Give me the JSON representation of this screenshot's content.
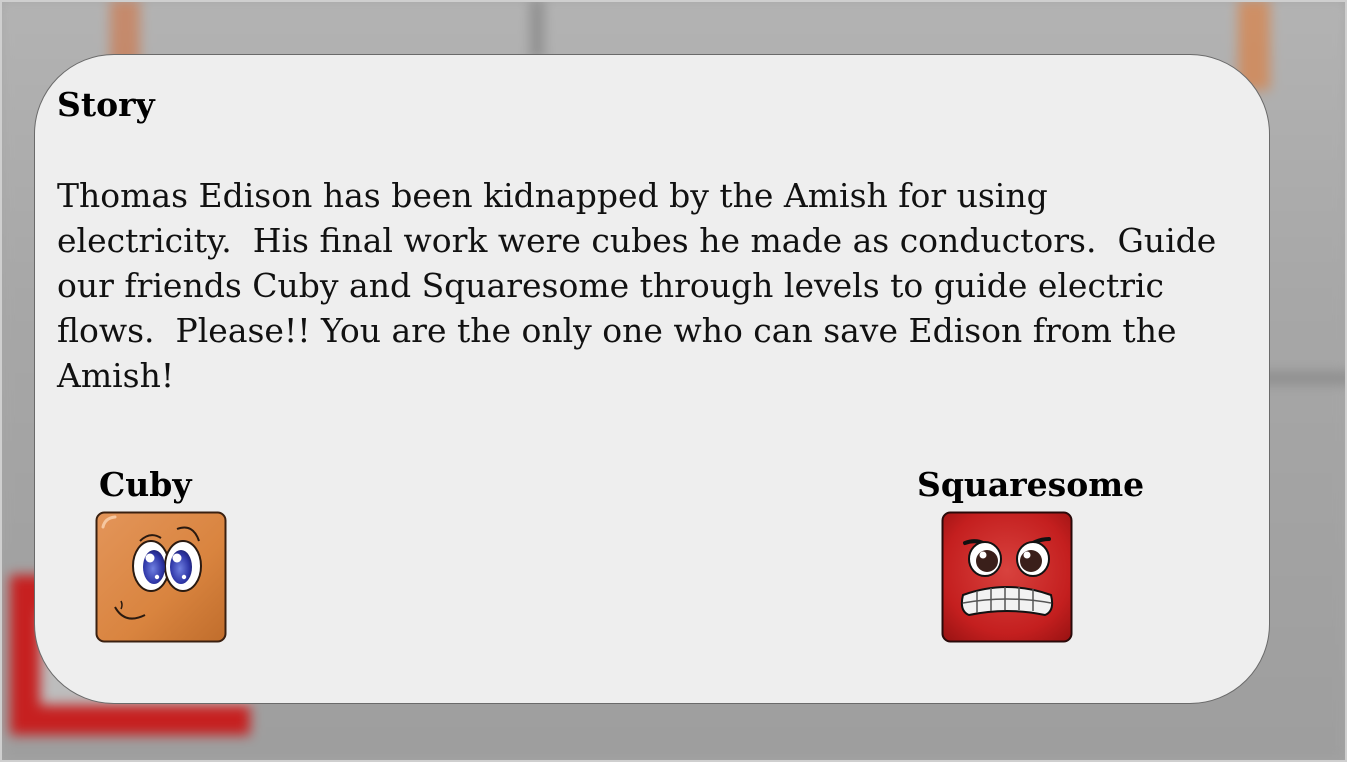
{
  "story": {
    "title": "Story",
    "text": "Thomas Edison has been kidnapped by the Amish for using\nelectricity.  His final work were cubes he made as conductors.  Guide\nour friends Cuby and Squaresome through levels to guide electric\nflows.  Please!! You are the only one who can save Edison from the\nAmish!"
  },
  "characters": {
    "cuby": {
      "name": "Cuby",
      "color": "#d9843f"
    },
    "squaresome": {
      "name": "Squaresome",
      "color": "#c41f1f"
    }
  }
}
